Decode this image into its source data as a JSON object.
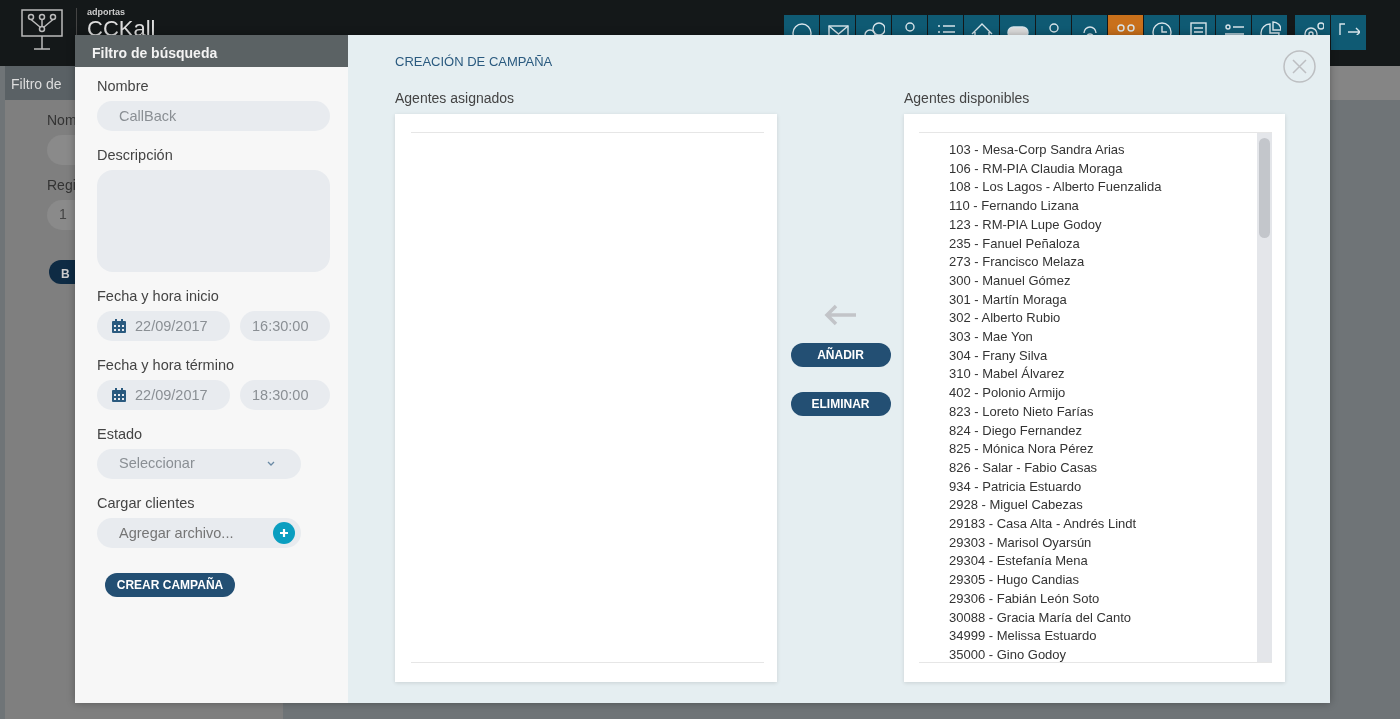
{
  "app": {
    "brand": "adportas",
    "product": "CCKall",
    "toolbar": [
      {
        "selected": false
      },
      {
        "selected": false
      },
      {
        "selected": false
      },
      {
        "selected": false
      },
      {
        "selected": false
      },
      {
        "selected": false
      },
      {
        "selected": false
      },
      {
        "selected": false
      },
      {
        "selected": false
      },
      {
        "selected": true
      },
      {
        "selected": false
      },
      {
        "selected": false
      },
      {
        "selected": false
      },
      {
        "selected": false
      }
    ],
    "toolbar_right": [
      {
        "selected": false
      },
      {
        "selected": false
      }
    ]
  },
  "background": {
    "subheader": "Filtro de",
    "labels": [
      "Nom",
      "Regi"
    ],
    "field_value": "1",
    "button": "B"
  },
  "filter_panel": {
    "title": "Filtro de búsqueda",
    "fields": [
      {
        "kind": "text",
        "label": "Nombre",
        "value": "CallBack"
      },
      {
        "kind": "textarea",
        "label": "Descripción"
      },
      {
        "kind": "datetime",
        "label": "Fecha y hora inicio",
        "date": "22/09/2017",
        "time": "16:30:00"
      },
      {
        "kind": "datetime",
        "label": "Fecha y hora término",
        "date": "22/09/2017",
        "time": "18:30:00"
      },
      {
        "kind": "select",
        "label": "Estado",
        "value": "Seleccionar"
      },
      {
        "kind": "file",
        "label": "Cargar clientes",
        "placeholder": "Agregar archivo..."
      }
    ],
    "submit": "CREAR CAMPAÑA"
  },
  "campaign": {
    "title": "CREACIÓN DE CAMPAÑA",
    "assigned": {
      "label": "Agentes asignados"
    },
    "add_button": "AÑADIR",
    "remove_button": "ELIMINAR",
    "available": {
      "label": "Agentes disponibles",
      "items": [
        "103 - Mesa-Corp Sandra Arias",
        "106 - RM-PIA Claudia Moraga",
        "108 - Los Lagos - Alberto Fuenzalida",
        "110 - Fernando Lizana",
        "123 - RM-PIA Lupe Godoy",
        "235 - Fanuel Peñaloza",
        "273 - Francisco Melaza",
        "300 - Manuel Gómez",
        "301 - Martín Moraga",
        "302 - Alberto Rubio",
        "303 - Mae Yon",
        "304 - Frany Silva",
        "310 - Mabel Álvarez",
        "402 - Polonio Armijo",
        "823 - Loreto Nieto Farías",
        "824 - Diego Fernandez",
        "825 - Mónica Nora Pérez",
        "826 - Salar - Fabio Casas",
        "934 - Patricia Estuardo",
        "2928 - Miguel Cabezas",
        "29183 - Casa Alta - Andrés Lindt",
        "29303 - Marisol Oyarsún",
        "29304 - Estefanía Mena",
        "29305 - Hugo Candias",
        "29306 - Fabián León Soto",
        "30088 - Gracia María del Canto",
        "34999 - Melissa Estuardo",
        "35000 - Gino Godoy"
      ]
    }
  }
}
